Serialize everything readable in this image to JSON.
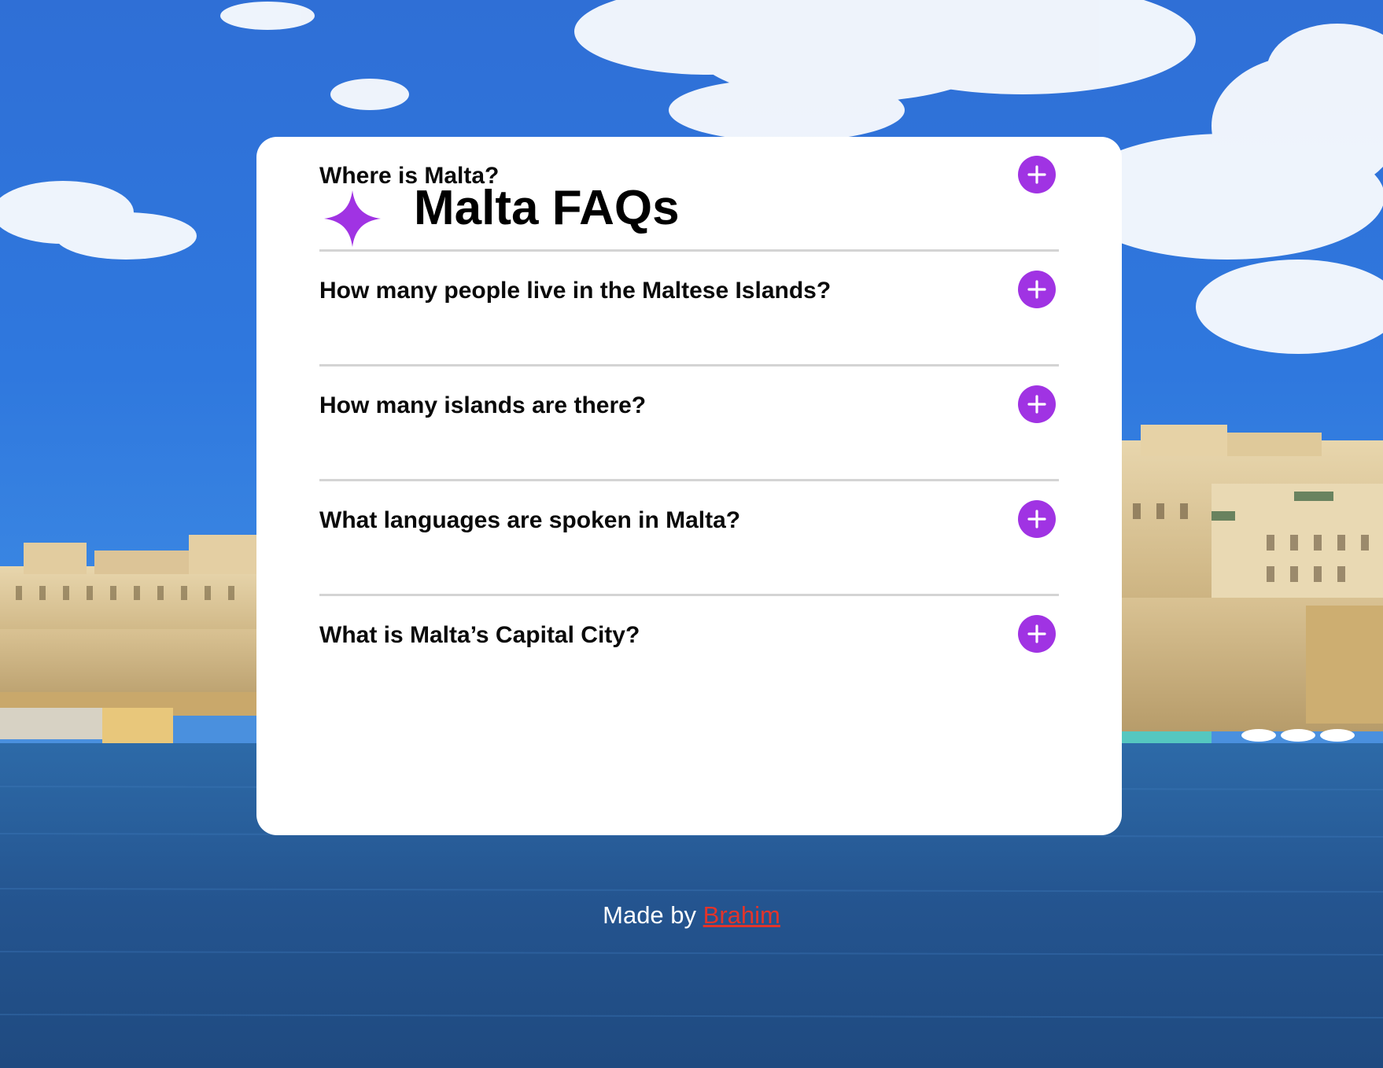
{
  "faq": {
    "title": "Malta FAQs",
    "items": [
      {
        "question": "Where is Malta?",
        "expanded": false
      },
      {
        "question": "How many people live in the Maltese Islands?",
        "expanded": false
      },
      {
        "question": "How many islands are there?",
        "expanded": false
      },
      {
        "question": "What languages are spoken in Malta?",
        "expanded": false
      },
      {
        "question": "What is Malta’s Capital City?",
        "expanded": false
      }
    ]
  },
  "footer": {
    "prefix": "Made by",
    "author_link": "Brahim"
  },
  "colors": {
    "accent": "#a033e3",
    "card": "#ffffff",
    "link": "#e3342a",
    "divider": "#d4d4d4"
  },
  "icons": {
    "header": "sparkle-icon",
    "toggle": "plus-icon"
  }
}
